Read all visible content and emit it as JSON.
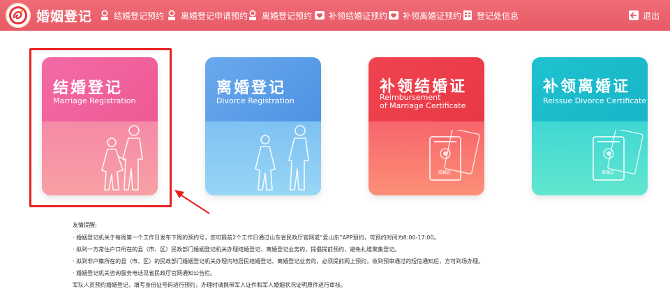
{
  "header": {
    "brand": "婚姻登记",
    "nav": [
      {
        "label": "结婚登记预约",
        "icon": "ring-icon"
      },
      {
        "label": "离婚登记申请预约",
        "icon": "ring-icon"
      },
      {
        "label": "离婚登记预约",
        "icon": "ring-icon"
      },
      {
        "label": "补领结婚证预约",
        "icon": "heart-certificate-icon"
      },
      {
        "label": "补领离婚证预约",
        "icon": "heart-certificate-icon"
      },
      {
        "label": "登记处信息",
        "icon": "building-icon"
      }
    ],
    "logout": "退出"
  },
  "cards": [
    {
      "cn": "结婚登记",
      "en": "Marriage Registration"
    },
    {
      "cn": "离婚登记",
      "en": "Divorce Registration"
    },
    {
      "cn": "补领结婚证",
      "en_line1": "Reimbursement",
      "en_line2": "of Marriage Certificate",
      "cert_label": "结婚证"
    },
    {
      "cn": "补领离婚证",
      "en": "Reissue Divorce Certificate",
      "cert_label": "离婚证"
    }
  ],
  "tips": {
    "title": "友情提醒:",
    "items": [
      "· 婚姻登记机关于每周第一个工作日发布下周的预约号，您可提前2个工作日通过山东省民政厅官网或“爱山东”APP预约，可预约时间为8:00-17:00。",
      "· 拟到一方常住户口所在的县（市、区）民政部门婚姻登记机关办理结婚登记、离婚登记业务的，提倡提前预约，避免扎堆聚集登记。",
      "· 拟到非户籍所在的县（市、区）的民政部门婚姻登记机关办理内地居民结婚登记、离婚登记业务的，必须提前网上预约，收到预审通过的短信通知后，方可到场办理。",
      "· 婚姻登记机关咨询服务电话见省民政厅官网通知公告栏。",
      "军队人员预约婚姻登记，填写身份证号码进行预约，办理时请携带军人证件和军人婚姻状况证明原件进行审核。"
    ]
  },
  "colors": {
    "header": "#e85a66",
    "marriage": "#ee5a95",
    "divorce": "#4d93e4",
    "reissue_marriage": "#e83846",
    "reissue_divorce": "#17b6c8",
    "highlight": "#e81f1f"
  }
}
